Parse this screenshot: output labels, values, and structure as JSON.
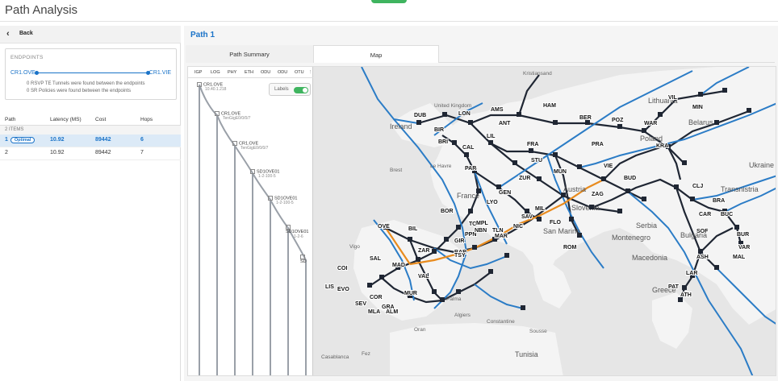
{
  "app": {
    "title": "Path Analysis"
  },
  "left": {
    "back_label": "Back",
    "endpoints": {
      "header": "ENDPOINTS",
      "source": "CR1.OVE",
      "destination": "CR1.VIE",
      "note1": "0 RSVP TE Tunnels were found between the endpoints",
      "note2": "0 SR Policies were found between the endpoints"
    },
    "table": {
      "headers": [
        "Path",
        "Latency (MS)",
        "Cost",
        "Hops"
      ],
      "count_label": "2 ITEMS",
      "rows": [
        {
          "path": "1",
          "badge": "Optimal",
          "latency": "10.92",
          "cost": "89442",
          "hops": "6"
        },
        {
          "path": "2",
          "badge": "",
          "latency": "10.92",
          "cost": "89442",
          "hops": "7"
        }
      ]
    }
  },
  "main": {
    "title": "Path 1",
    "tabs": [
      "Path Summary",
      "Map"
    ],
    "layers": {
      "tabs": [
        "IGP",
        "LOG",
        "PHY",
        "ETH",
        "ODU",
        "ODU",
        "OTU"
      ],
      "labels_toggle": "Labels",
      "hops": [
        {
          "name": "CR1.OVE",
          "sub": "10.40.1.218"
        },
        {
          "name": "CR1.OVE",
          "sub": "TenGigE0/0/0/7"
        },
        {
          "name": "CR1.OVE",
          "sub": "TenGigE0/0/0/7"
        },
        {
          "name": "SD1OVE01",
          "sub": "1-2-100-5"
        },
        {
          "name": "SD1OVE01",
          "sub": "1-2-100-5"
        },
        {
          "name": "SD1OVE01",
          "sub": "1-2-6"
        },
        {
          "name": "SD",
          "sub": ""
        }
      ]
    },
    "map": {
      "geo_labels": [
        "Ireland",
        "Lithuania",
        "Belarus",
        "Poland",
        "Ukraine",
        "France",
        "Austria",
        "Slovenia",
        "San Marino",
        "Serbia",
        "Montenegro",
        "Bulgaria",
        "Macedonia",
        "Greece",
        "Transnistria",
        "Algiers",
        "Tunisia",
        "Constantine",
        "Oran",
        "Casablanca",
        "Fez",
        "Palma",
        "Vigo",
        "Le Havre",
        "Brest",
        "Sousse",
        "Kristiansand",
        "United Kingdom"
      ],
      "city_nodes": [
        "DUB",
        "BIR",
        "BRI",
        "LON",
        "AMS",
        "ANT",
        "LIL",
        "CAL",
        "PAR",
        "FRA",
        "STU",
        "ZUR",
        "MUN",
        "BER",
        "HAM",
        "POZ",
        "WAR",
        "KRA",
        "PRA",
        "VIE",
        "BUD",
        "ZAG",
        "MIL",
        "GEN",
        "LYO",
        "NIC",
        "SAV",
        "FLO",
        "ROM",
        "MAR",
        "TOU",
        "BOR",
        "BIL",
        "OVE",
        "MAD",
        "SAL",
        "COI",
        "LIS",
        "EVO",
        "SEV",
        "COR",
        "GRA",
        "MLA",
        "ALM",
        "MUR",
        "VAL",
        "ZAR",
        "BAR",
        "GIR",
        "PPN",
        "MPL",
        "TLN",
        "TSY",
        "CLJ",
        "BRA",
        "BUC",
        "CAR",
        "SOF",
        "BUR",
        "VAR",
        "MAL",
        "ASH",
        "LAR",
        "PAT",
        "ATH",
        "VIL",
        "MIN",
        "NBN"
      ]
    },
    "colors": {
      "accent": "#1a73c8",
      "optimal_path": "#e88b1e",
      "link_dark": "#1f2633",
      "link_blue": "#2b7cc6",
      "toggle_on": "#3fb45f"
    }
  }
}
